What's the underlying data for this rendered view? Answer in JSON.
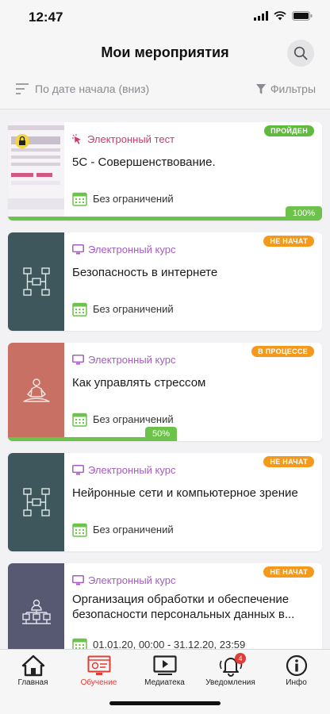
{
  "status_bar": {
    "time": "12:47"
  },
  "header": {
    "title": "Мои мероприятия"
  },
  "toolbar": {
    "sort_label": "По дате начала (вниз)",
    "filters_label": "Фильтры"
  },
  "colors": {
    "accent_red": "#e23c36",
    "progress_green": "#6cc24a",
    "badge_orange": "#f39a1d",
    "course_purple": "#a65bc2",
    "test_pink": "#cc3a6a"
  },
  "events": [
    {
      "type": "Электронный тест",
      "title": "5С - Совершенствование.",
      "dates": "Без ограничений",
      "status": "ПРОЙДЕН",
      "progress_label": "100%",
      "progress": 1.0,
      "thumb": "screen-lock-icon",
      "thumb_color": "#e9e3ee"
    },
    {
      "type": "Электронный курс",
      "title": "Безопасность в интернете",
      "dates": "Без ограничений",
      "status": "НЕ НАЧАТ",
      "thumb": "network-icon",
      "thumb_color": "#3d575d"
    },
    {
      "type": "Электронный курс",
      "title": "Как управлять стрессом",
      "dates": "Без ограничений",
      "status": "В ПРОЦЕССЕ",
      "progress_label": "50%",
      "progress": 0.5,
      "thumb": "meditation-icon",
      "thumb_color": "#c77063"
    },
    {
      "type": "Электронный курс",
      "title": "Нейронные сети и компьютерное зрение",
      "dates": "Без ограничений",
      "status": "НЕ НАЧАТ",
      "thumb": "network-icon",
      "thumb_color": "#3d575d"
    },
    {
      "type": "Электронный курс",
      "title": "Организация обработки и обеспечение безопасности персональных данных в...",
      "dates": "01.01.20, 00:00 - 31.12.20, 23:59",
      "status": "НЕ НАЧАТ",
      "thumb": "data-security-icon",
      "thumb_color": "#575872"
    }
  ],
  "tabbar": {
    "tabs": [
      {
        "label": "Главная",
        "icon": "home-icon"
      },
      {
        "label": "Обучение",
        "icon": "learning-icon"
      },
      {
        "label": "Медиатека",
        "icon": "media-icon"
      },
      {
        "label": "Уведомления",
        "icon": "bell-icon",
        "badge": "4"
      },
      {
        "label": "Инфо",
        "icon": "info-icon"
      }
    ],
    "active": "Обучение"
  }
}
